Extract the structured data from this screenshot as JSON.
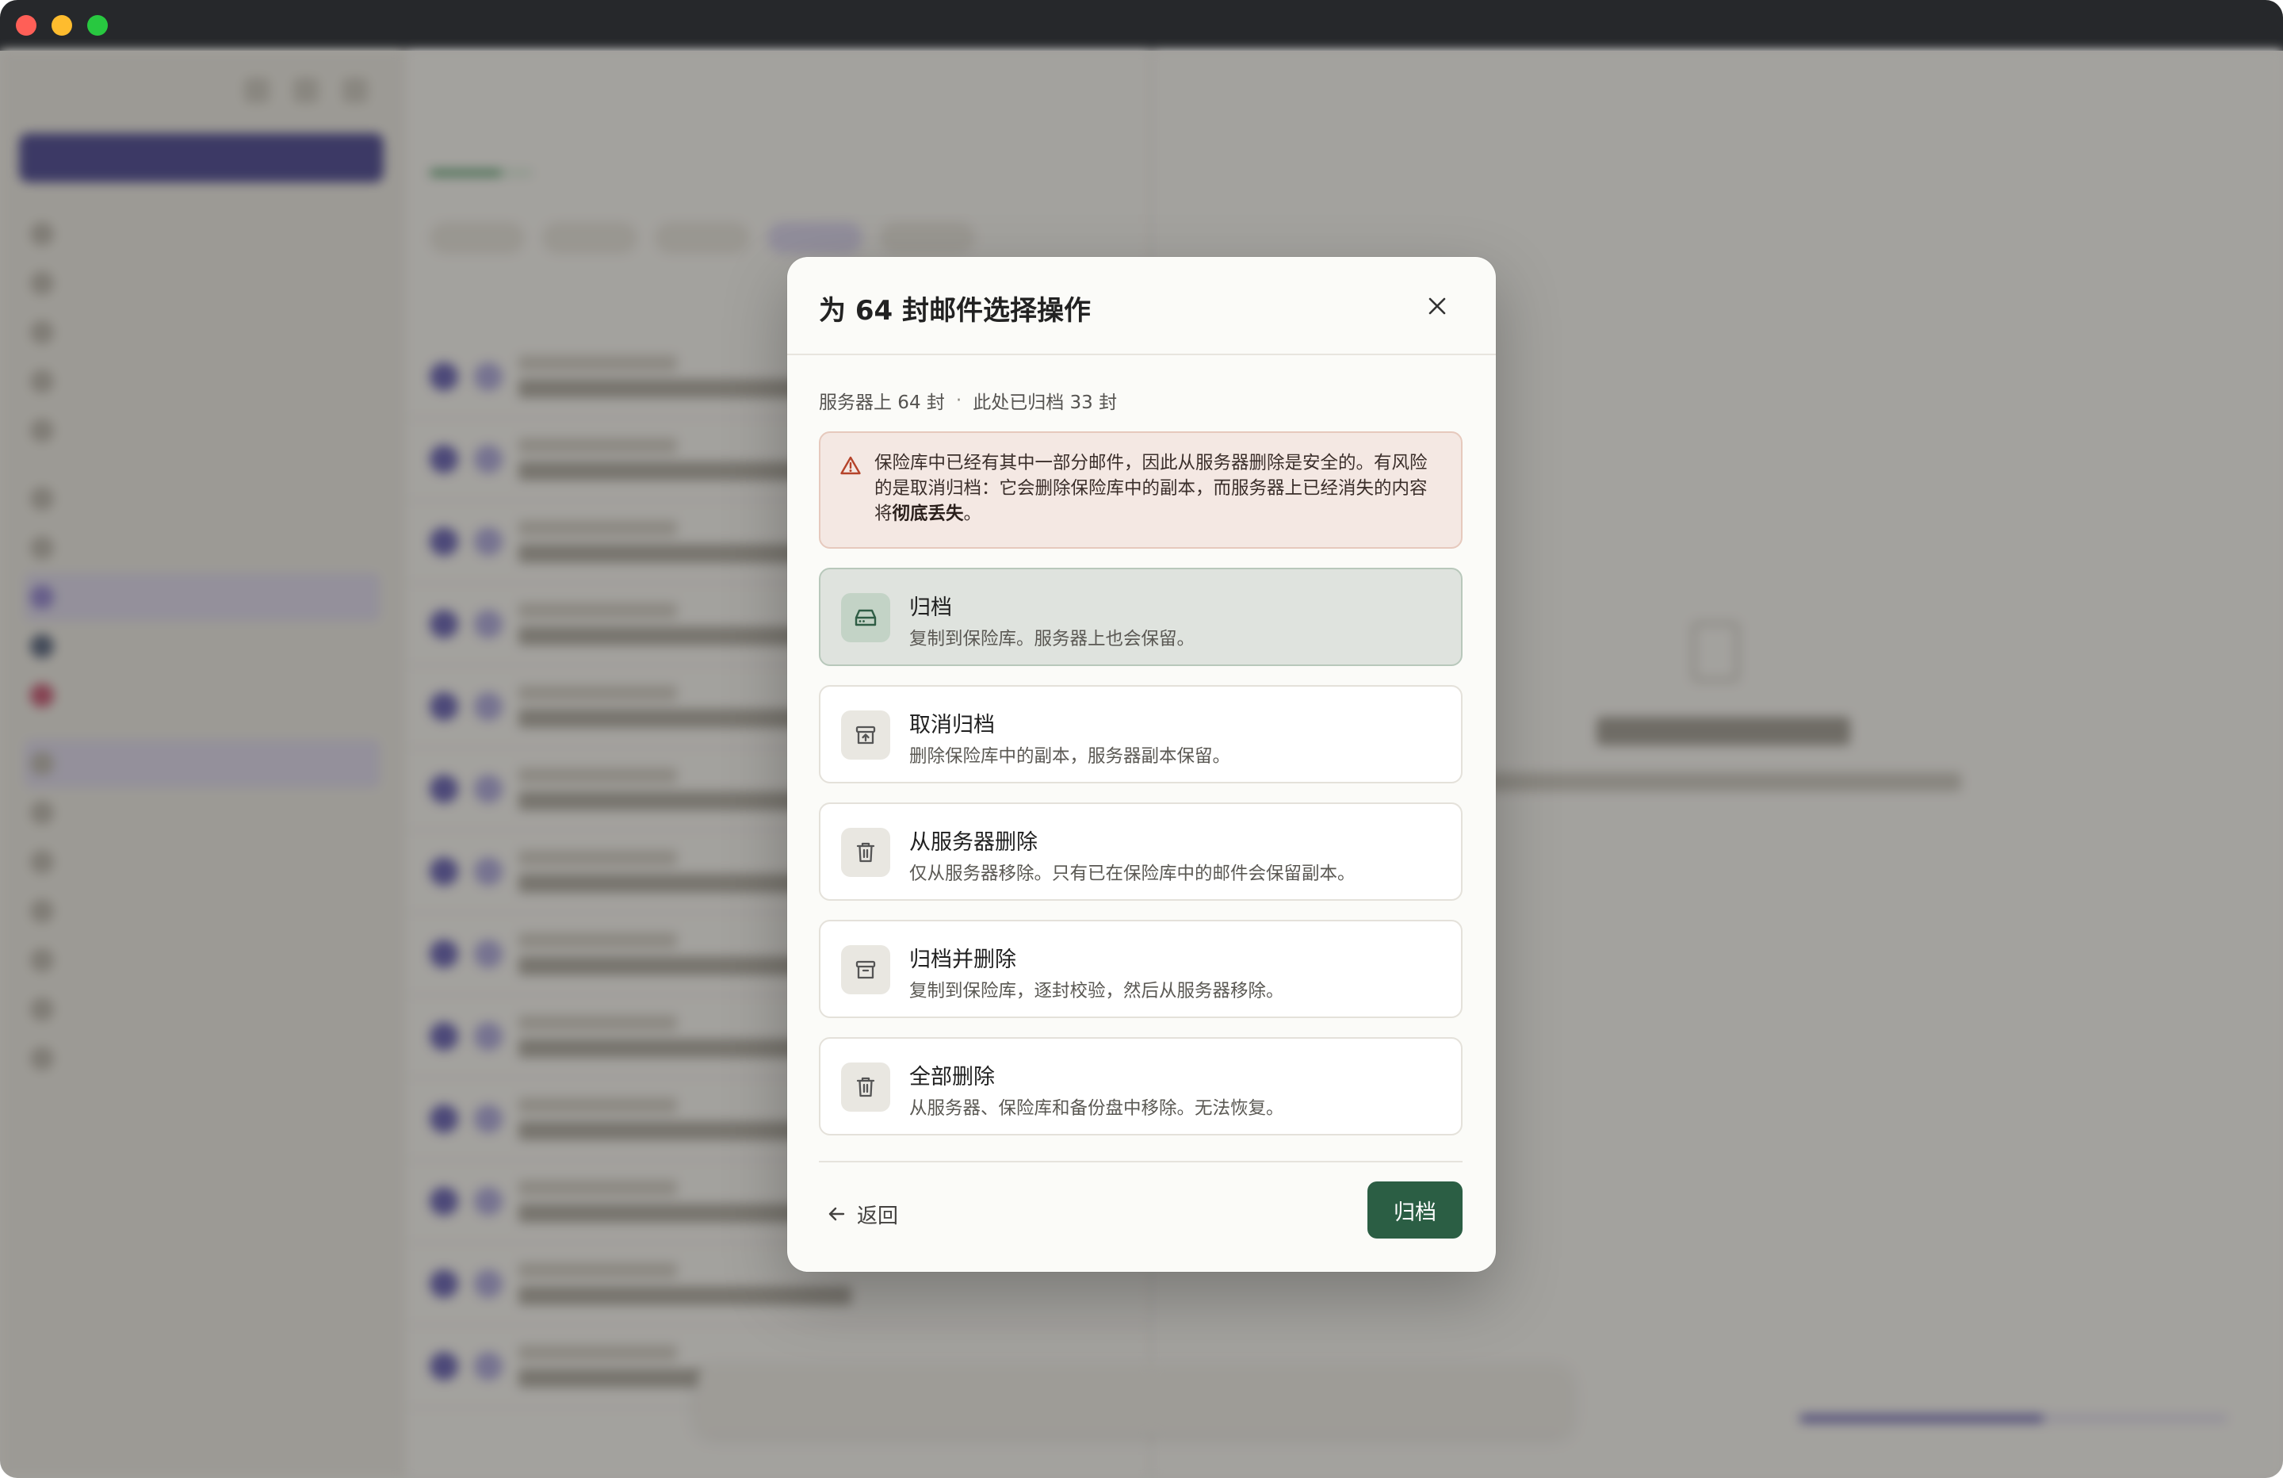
{
  "modal": {
    "title": "为 64 封邮件选择操作",
    "counts": {
      "on_server": "服务器上 64 封",
      "separator": "·",
      "archived_here": "此处已归档 33 封"
    },
    "warning": {
      "text_before": "保险库中已经有其中一部分邮件，因此从服务器删除是安全的。有风险的是取消归档：它会删除保险库中的副本，而服务器上已经消失的内容将",
      "text_bold": "彻底丢失",
      "text_after": "。"
    },
    "options": [
      {
        "icon": "drive-icon",
        "title": "归档",
        "description": "复制到保险库。服务器上也会保留。",
        "selected": true
      },
      {
        "icon": "unarchive-icon",
        "title": "取消归档",
        "description": "删除保险库中的副本，服务器副本保留。",
        "selected": false
      },
      {
        "icon": "trash-icon",
        "title": "从服务器删除",
        "description": "仅从服务器移除。只有已在保险库中的邮件会保留副本。",
        "selected": false
      },
      {
        "icon": "archive-box-icon",
        "title": "归档并删除",
        "description": "复制到保险库，逐封校验，然后从服务器移除。",
        "selected": false
      },
      {
        "icon": "trash-icon",
        "title": "全部删除",
        "description": "从服务器、保险库和备份盘中移除。无法恢复。",
        "selected": false
      }
    ],
    "back_label": "返回",
    "primary_label": "归档"
  },
  "colors": {
    "primary_button": "#2b5e44",
    "warning_bg": "#f4e8e3",
    "warning_icon": "#b5432a",
    "selected_option_bg": "#dfe3de"
  }
}
